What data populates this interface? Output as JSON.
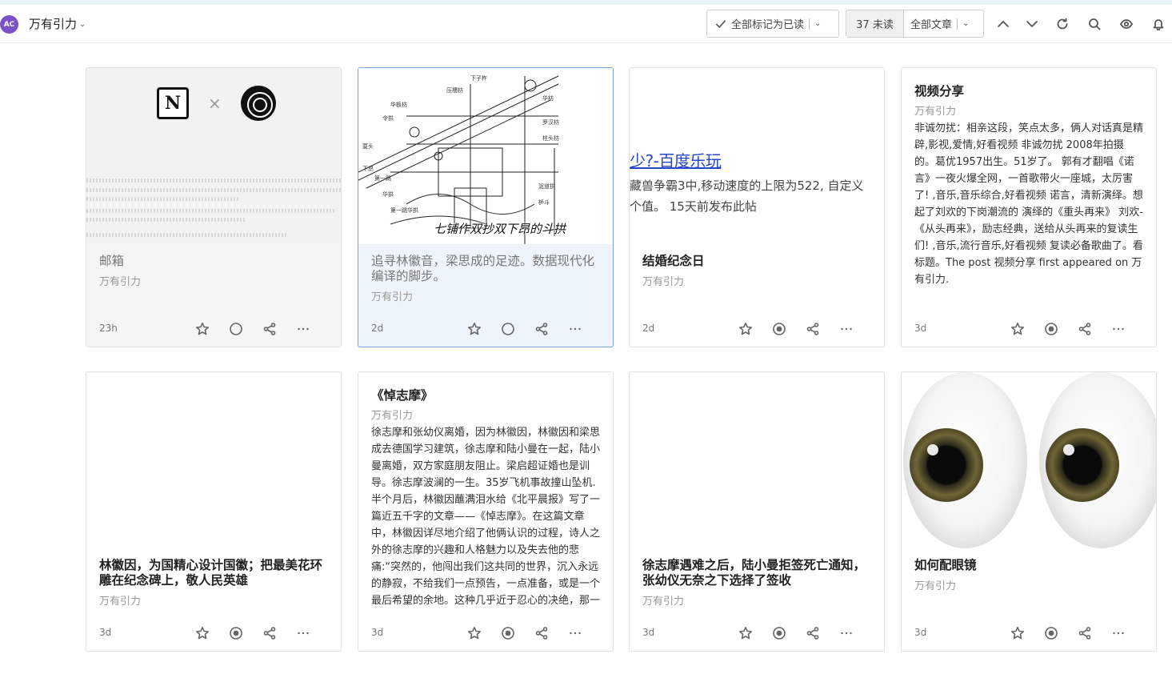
{
  "header": {
    "avatar_text": "AC",
    "feed_title": "万有引力",
    "mark_all_read": "全部标记为已读",
    "unread_count": "37 未读",
    "filter": "全部文章"
  },
  "colors": {
    "accent": "#7b50c9",
    "selected_border": "#7aa5d8",
    "link_blue": "#2a46c8"
  },
  "icons": [
    "check-icon",
    "chevron-down-icon",
    "chevron-up-icon",
    "refresh-icon",
    "search-icon",
    "eye-icon",
    "bell-icon",
    "star-icon",
    "circle-icon",
    "dot-circle-icon",
    "share-icon",
    "more-icon"
  ],
  "cards": [
    {
      "title": "邮箱",
      "source": "万有引力",
      "age": "23h"
    },
    {
      "title": "追寻林徽音，梁思成的足迹。数据现代化编译的脚步。",
      "source": "万有引力",
      "age": "2d",
      "image_caption": "七铺作双抄双下昂的斗拱"
    },
    {
      "title": "结婚纪念日",
      "source": "万有引力",
      "age": "2d",
      "image_lines": [
        "少?-百度乐玩",
        "藏兽争霸3中,移动速度的上限为522, 自定义",
        "个值。 15天前发布此帖"
      ]
    },
    {
      "title": "视频分享",
      "source": "万有引力",
      "age": "3d",
      "excerpt": "非诚勿扰：相亲这段，笑点太多，俩人对话真是精辟,影视,爱情,好看视频 非诚勿扰 2008年拍摄的。葛优1957出生。51岁了。 郭有才翻唱《诺言》一夜火爆全网，一首歌带火一座城，太厉害了! ,音乐,音乐综合,好看视频 诺言，清新演绎。想起了刘欢的下岗潮流的 演绎的《重头再来》 刘欢-《从头再来》，励志经典，送给从头再来的复读生们! ,音乐,流行音乐,好看视频 复读必备歌曲了。看标题。The post 视频分享 first appeared on 万有引力."
    },
    {
      "title": "林徽因，为国精心设计国徽；把最美花环雕在纪念碑上，敬人民英雄",
      "source": "万有引力",
      "age": "3d"
    },
    {
      "title": "《悼志摩》",
      "source": "万有引力",
      "age": "3d",
      "excerpt": "徐志摩和张幼仪离婚，因为林徽因，林徽因和梁思成去德国学习建筑，徐志摩和陆小曼在一起，陆小曼离婚，双方家庭朋友阻止。梁启超证婚也是训导。徐志摩波澜的一生。35岁飞机事故撞山坠机. 半个月后，林徽因蘸满泪水给《北平晨报》写了一篇近五千字的文章——《悼志摩》。在这篇文章中，林徽因详尽地介绍了他俩认识的过程，诗人之外的徐志摩的兴趣和人格魅力以及失去他的悲痛:“突然的，他闯出我们这共同的世界，沉入永远的静寂，不给我们一点预告，一点准备，或是一个最后希望的余地。这种几乎近于忍心的决绝，那一"
    },
    {
      "title": "徐志摩遇难之后，陆小曼拒签死亡通知，张幼仪无奈之下选择了签收",
      "source": "万有引力",
      "age": "3d"
    },
    {
      "title": "如何配眼镜",
      "source": "万有引力",
      "age": "3d"
    }
  ]
}
